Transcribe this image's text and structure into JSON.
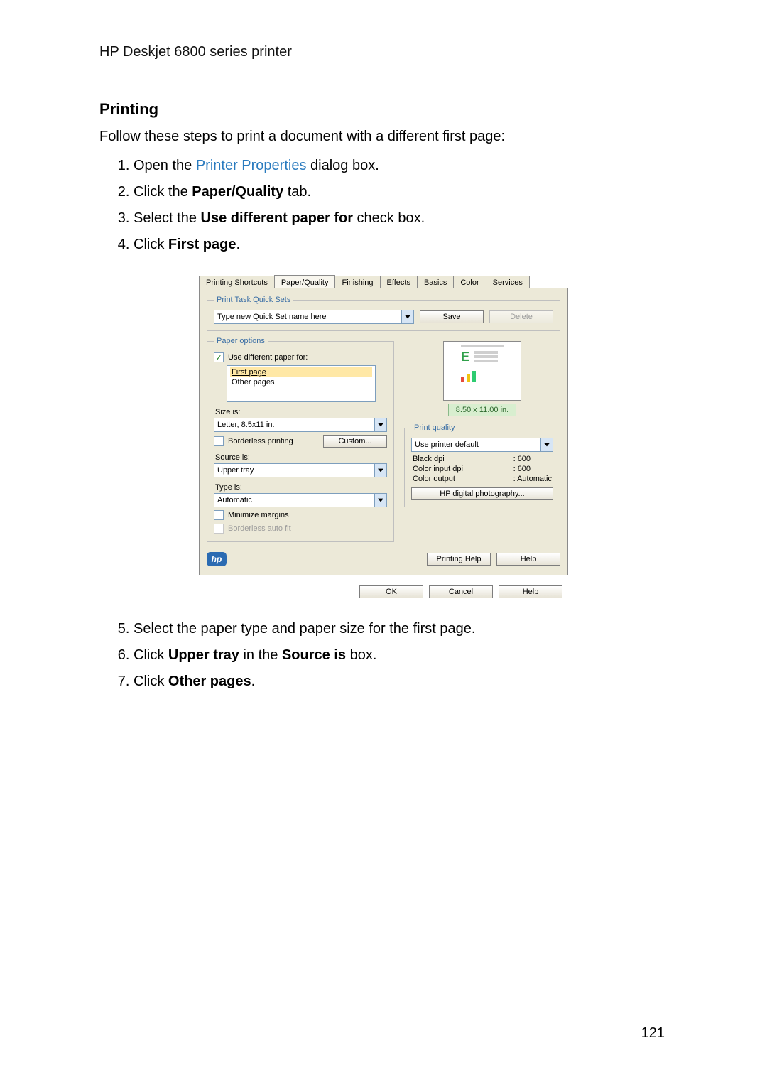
{
  "page": {
    "running_header": "HP Deskjet 6800 series printer",
    "section_title": "Printing",
    "lead": "Follow these steps to print a document with a different first page:",
    "page_number": "121"
  },
  "steps_top": {
    "s1_prefix": "Open the ",
    "s1_link": "Printer Properties",
    "s1_suffix": " dialog box.",
    "s2_prefix": "Click the ",
    "s2_bold": "Paper/Quality",
    "s2_suffix": " tab.",
    "s3_prefix": "Select the ",
    "s3_bold": "Use different paper for",
    "s3_suffix": " check box.",
    "s4_prefix": "Click ",
    "s4_bold": "First page",
    "s4_suffix": "."
  },
  "steps_bottom": {
    "s5": "Select the paper type and paper size for the first page.",
    "s6_prefix": "Click ",
    "s6_b1": "Upper tray",
    "s6_mid": " in the ",
    "s6_b2": "Source is",
    "s6_suffix": " box.",
    "s7_prefix": "Click ",
    "s7_bold": "Other pages",
    "s7_suffix": "."
  },
  "dialog": {
    "tabs": [
      "Printing Shortcuts",
      "Paper/Quality",
      "Finishing",
      "Effects",
      "Basics",
      "Color",
      "Services"
    ],
    "active_tab": "Paper/Quality",
    "quickset": {
      "legend": "Print Task Quick Sets",
      "placeholder": "Type new Quick Set name here",
      "save": "Save",
      "delete": "Delete"
    },
    "paper_options": {
      "legend": "Paper options",
      "use_different": "Use different paper for:",
      "list_first": "First page",
      "list_other": "Other pages",
      "size_label": "Size is:",
      "size_value": "Letter, 8.5x11 in.",
      "borderless_printing": "Borderless printing",
      "custom_btn": "Custom...",
      "source_label": "Source is:",
      "source_value": "Upper tray",
      "type_label": "Type is:",
      "type_value": "Automatic",
      "minimize_margins": "Minimize margins",
      "borderless_autofit": "Borderless auto fit"
    },
    "preview": {
      "dimensions": "8.50 x 11.00 in."
    },
    "print_quality": {
      "legend": "Print quality",
      "dropdown": "Use printer default",
      "black_label": "Black dpi",
      "black_val": ": 600",
      "colorin_label": "Color input dpi",
      "colorin_val": ": 600",
      "colorout_label": "Color output",
      "colorout_val": ": Automatic",
      "hp_photo": "HP digital photography..."
    },
    "bottom": {
      "printing_help": "Printing Help",
      "help": "Help",
      "ok": "OK",
      "cancel": "Cancel",
      "help2": "Help"
    }
  }
}
